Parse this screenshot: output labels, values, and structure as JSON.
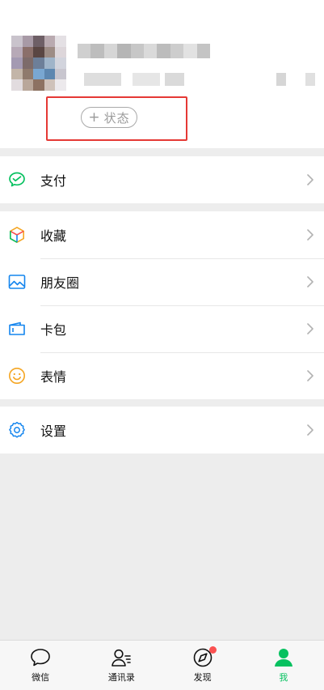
{
  "profile": {
    "status_plus": "+",
    "status_label": "状态"
  },
  "menu": {
    "pay": {
      "label": "支付",
      "icon": "wechat-pay-icon"
    },
    "favorites": {
      "label": "收藏",
      "icon": "cube-icon"
    },
    "moments": {
      "label": "朋友圈",
      "icon": "image-icon"
    },
    "cards": {
      "label": "卡包",
      "icon": "wallet-icon"
    },
    "stickers": {
      "label": "表情",
      "icon": "smile-icon"
    },
    "settings": {
      "label": "设置",
      "icon": "gear-icon"
    }
  },
  "tabbar": {
    "chats": "微信",
    "contacts": "通讯录",
    "discover": "发现",
    "me": "我"
  },
  "colors": {
    "accent": "#07c160",
    "highlight_box": "#e53935",
    "badge": "#fa5151",
    "background": "#ededed"
  }
}
